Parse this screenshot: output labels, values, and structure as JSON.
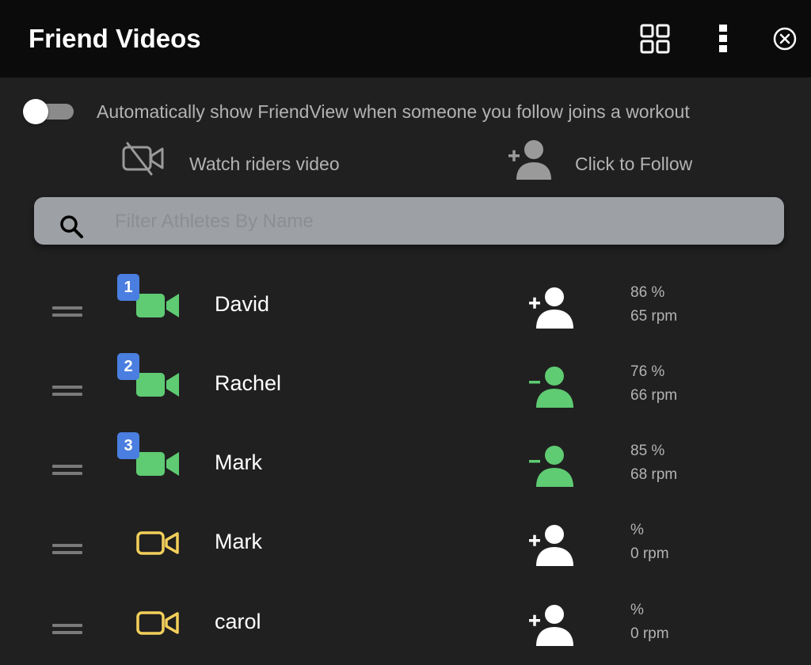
{
  "header": {
    "title": "Friend Videos",
    "grid_icon": "grid-view-icon",
    "more_icon": "more-vertical-icon",
    "close_icon": "close-circle-icon"
  },
  "settings": {
    "auto_show_label": "Automatically show FriendView when someone you follow joins a workout",
    "auto_show_enabled": false
  },
  "legend": {
    "video_label": "Watch riders video",
    "video_icon": "video-off-icon",
    "follow_label": "Click to Follow",
    "follow_icon": "add-person-icon"
  },
  "search": {
    "placeholder": "Filter Athletes By Name",
    "value": ""
  },
  "colors": {
    "header_bg": "#0b0b0b",
    "panel_bg": "#202020",
    "green": "#5fcb73",
    "yellow": "#f2cf5b",
    "badge_blue": "#4a7ee0",
    "text_muted": "#b3b3b3",
    "search_bg": "#9da0a5"
  },
  "riders": [
    {
      "order": "1",
      "name": "David",
      "video_state": "active",
      "following": false,
      "power": "86 %",
      "cadence": "65 rpm"
    },
    {
      "order": "2",
      "name": "Rachel",
      "video_state": "active",
      "following": true,
      "power": "76 %",
      "cadence": "66 rpm"
    },
    {
      "order": "3",
      "name": "Mark",
      "video_state": "active",
      "following": true,
      "power": "85 %",
      "cadence": "68 rpm"
    },
    {
      "order": "",
      "name": "Mark",
      "video_state": "available",
      "following": false,
      "power": "%",
      "cadence": "0 rpm"
    },
    {
      "order": "",
      "name": "carol",
      "video_state": "available",
      "following": false,
      "power": "%",
      "cadence": "0 rpm"
    }
  ]
}
